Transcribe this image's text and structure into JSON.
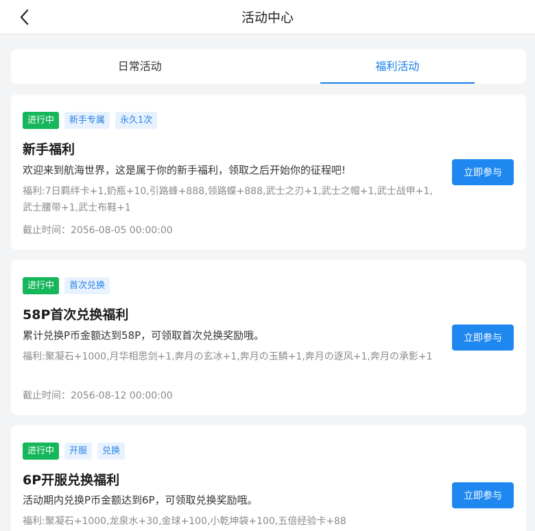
{
  "header": {
    "title": "活动中心"
  },
  "tabs": [
    {
      "label": "日常活动",
      "active": false
    },
    {
      "label": "福利活动",
      "active": true
    }
  ],
  "cards": [
    {
      "status": "进行中",
      "tags": [
        "新手专属",
        "永久1次"
      ],
      "title": "新手福利",
      "description": "欢迎来到航海世界，这是属于你的新手福利，领取之后开始你的征程吧!",
      "reward": "福利:7日羁绊卡+1,奶瓶+10,引路蜂+888,领路蝶+888,武士之刃+1,武士之帽+1,武士战甲+1,武士腰带+1,武士布鞋+1",
      "deadline": "截止时间：2056-08-05 00:00:00",
      "button": "立即参与"
    },
    {
      "status": "进行中",
      "tags": [
        "首次兑换"
      ],
      "title": "58P首次兑换福利",
      "description": "累计兑换P币金额达到58P，可领取首次兑换奖励哦。",
      "reward": "福利:聚凝石+1000,月华相思剑+1,奔月の玄冰+1,奔月の玉鳞+1,奔月の逐风+1,奔月の承影+1",
      "deadline": "截止时间：2056-08-12 00:00:00",
      "button": "立即参与"
    },
    {
      "status": "进行中",
      "tags": [
        "开服",
        "兑换"
      ],
      "title": "6P开服兑换福利",
      "description": "活动期内兑换P币金额达到6P，可领取兑换奖励哦。",
      "reward": "福利:聚凝石+1000,龙泉水+30,金球+100,小乾坤袋+100,五倍经验卡+88",
      "button": "立即参与"
    }
  ],
  "colors": {
    "accent": "#1a7fe8",
    "status_green": "#16b65b",
    "tag_bg": "#e8f2ff",
    "page_bg": "#f3f4f6"
  },
  "icons": {
    "back": "chevron-left-icon"
  }
}
